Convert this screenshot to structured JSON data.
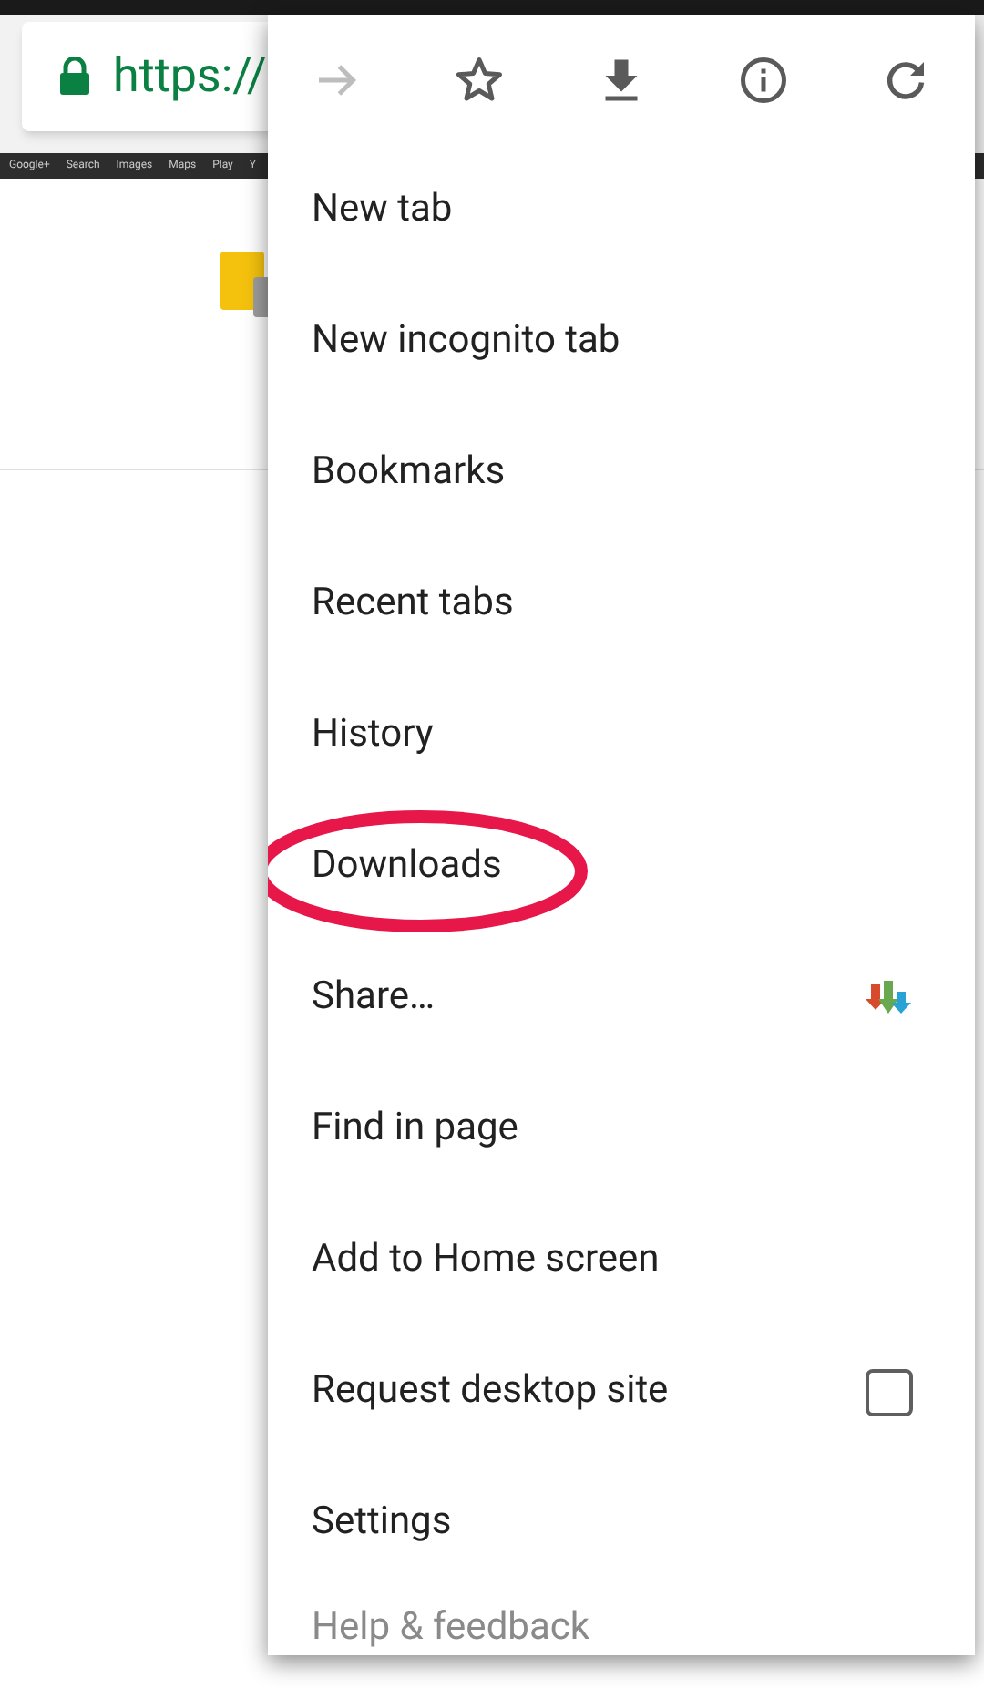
{
  "address_bar": {
    "url": "https://"
  },
  "google_bar": {
    "links": [
      "Google+",
      "Search",
      "Images",
      "Maps",
      "Play",
      "Y"
    ]
  },
  "menu": {
    "toolbar": [
      {
        "kind": "forward",
        "disabled": true
      },
      {
        "kind": "star",
        "disabled": false
      },
      {
        "kind": "download",
        "disabled": false
      },
      {
        "kind": "info",
        "disabled": false
      },
      {
        "kind": "reload",
        "disabled": false
      }
    ],
    "items": [
      {
        "label": "New tab",
        "kind": "plain"
      },
      {
        "label": "New incognito tab",
        "kind": "plain"
      },
      {
        "label": "Bookmarks",
        "kind": "plain"
      },
      {
        "label": "Recent tabs",
        "kind": "plain"
      },
      {
        "label": "History",
        "kind": "plain"
      },
      {
        "label": "Downloads",
        "kind": "plain",
        "circled": true
      },
      {
        "label": "Share…",
        "kind": "share"
      },
      {
        "label": "Find in page",
        "kind": "plain"
      },
      {
        "label": "Add to Home screen",
        "kind": "plain"
      },
      {
        "label": "Request desktop site",
        "kind": "checkbox",
        "checked": false
      },
      {
        "label": "Settings",
        "kind": "plain"
      },
      {
        "label": "Help & feedback",
        "kind": "faded"
      }
    ]
  }
}
